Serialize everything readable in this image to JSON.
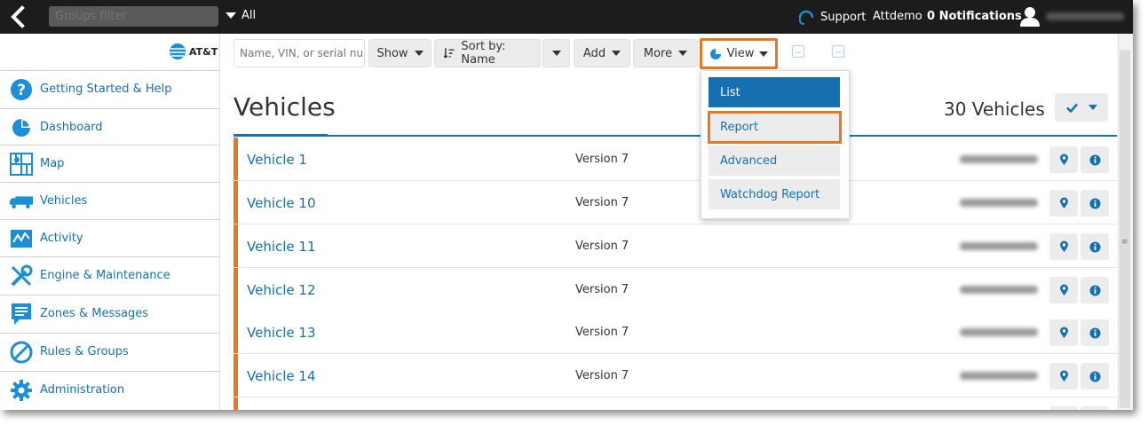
{
  "topbar": {
    "groups_filter_placeholder": "Groups filter",
    "groups_scope": "All",
    "support_label": "Support",
    "user_name": "Attdemo",
    "notifications_label": "0 Notifications"
  },
  "sidebar": {
    "brand": "AT&T",
    "items": [
      {
        "label": "Getting Started & Help",
        "icon": "help-circle-icon"
      },
      {
        "label": "Dashboard",
        "icon": "pie-chart-icon"
      },
      {
        "label": "Map",
        "icon": "map-icon"
      },
      {
        "label": "Vehicles",
        "icon": "truck-icon"
      },
      {
        "label": "Activity",
        "icon": "activity-chart-icon"
      },
      {
        "label": "Engine & Maintenance",
        "icon": "wrench-icon"
      },
      {
        "label": "Zones & Messages",
        "icon": "message-icon"
      },
      {
        "label": "Rules & Groups",
        "icon": "prohibited-icon"
      },
      {
        "label": "Administration",
        "icon": "gear-icon"
      }
    ]
  },
  "toolbar": {
    "search_placeholder": "Name, VIN, or serial num",
    "show_label": "Show",
    "sort_label": "Sort by: Name",
    "add_label": "Add",
    "more_label": "More",
    "view_label": "View"
  },
  "view_menu": {
    "items": [
      {
        "label": "List",
        "active": true
      },
      {
        "label": "Report",
        "active": false,
        "highlighted": true
      },
      {
        "label": "Advanced",
        "active": false
      },
      {
        "label": "Watchdog Report",
        "active": false
      }
    ]
  },
  "main": {
    "title": "Vehicles",
    "count_label": "30 Vehicles",
    "rows": [
      {
        "name": "Vehicle 1",
        "version": "Version 7"
      },
      {
        "name": "Vehicle 10",
        "version": "Version 7"
      },
      {
        "name": "Vehicle 11",
        "version": "Version 7"
      },
      {
        "name": "Vehicle 12",
        "version": "Version 7"
      },
      {
        "name": "Vehicle 13",
        "version": "Version 7"
      },
      {
        "name": "Vehicle 14",
        "version": "Version 7"
      }
    ]
  },
  "colors": {
    "accent": "#1670b0",
    "highlight": "#e87722",
    "topbar": "#1c1c1c"
  }
}
